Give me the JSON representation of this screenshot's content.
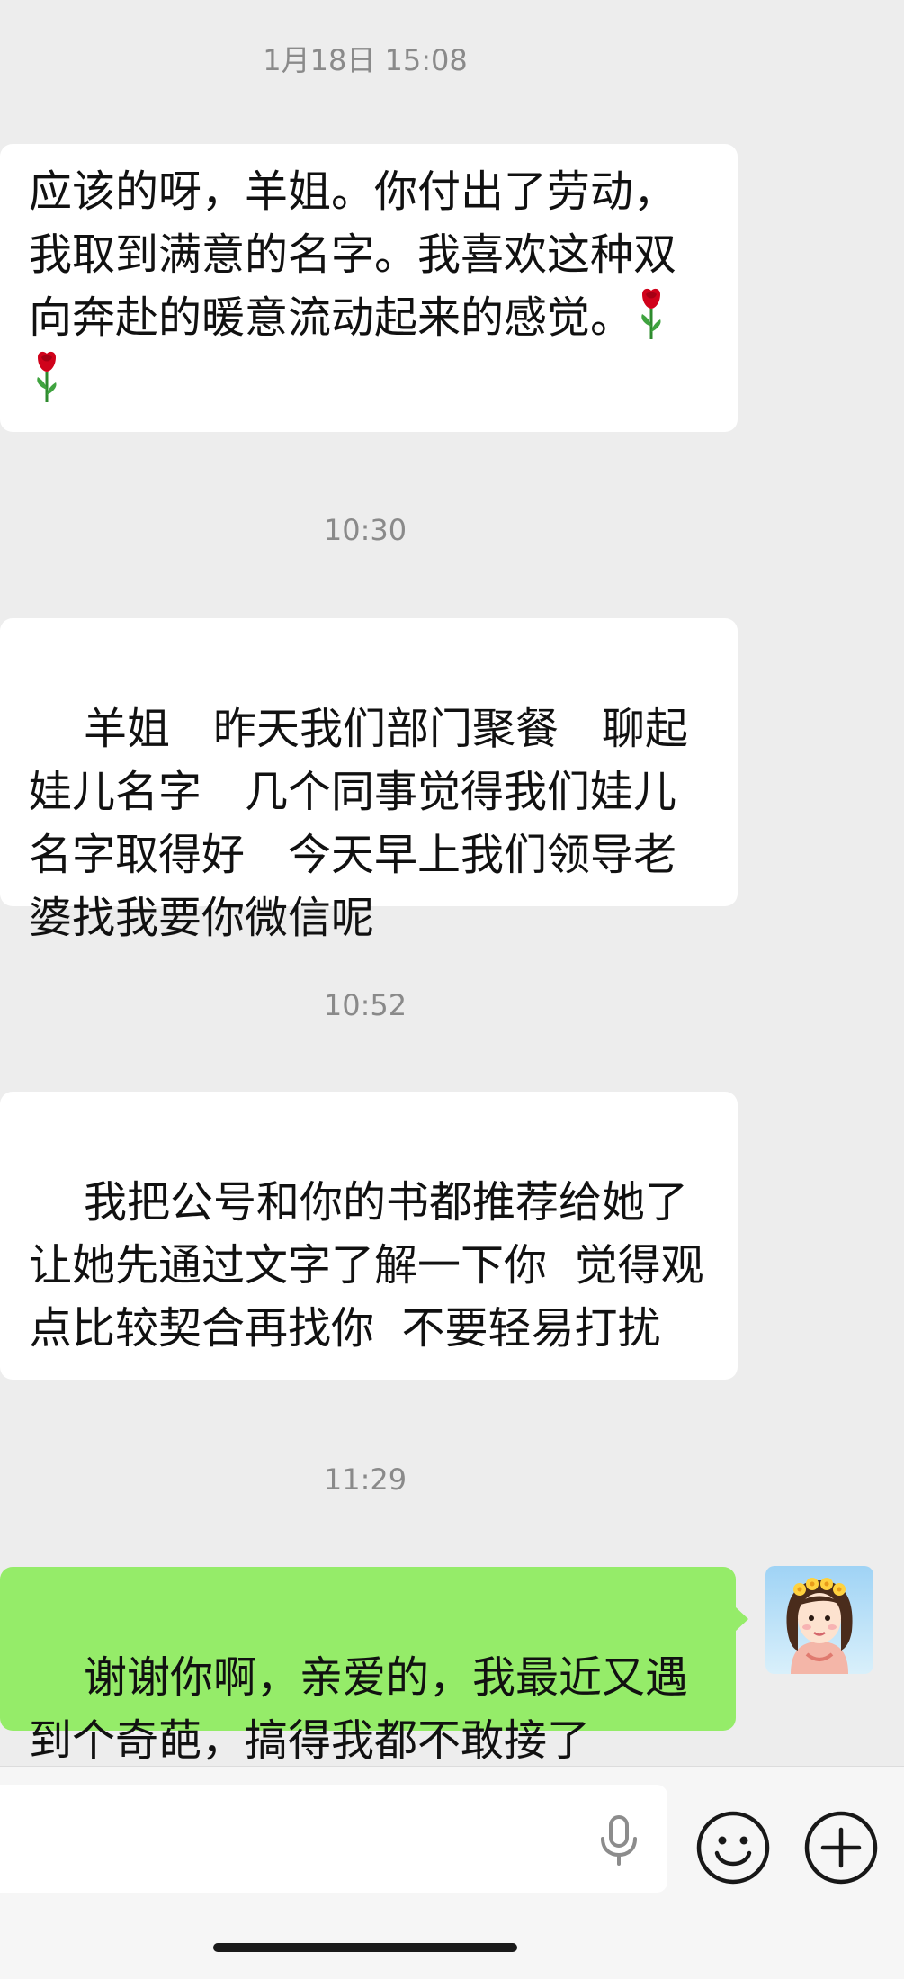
{
  "chat": {
    "messages": [
      {
        "type": "timestamp",
        "text": "1月18日 15:08"
      },
      {
        "type": "incoming",
        "text": "应该的呀，羊姐。你付出了劳动，我取到满意的名字。我喜欢这种双向奔赴的暖意流动起来的感觉。",
        "emoji": [
          "rose-emoji",
          "rose-emoji"
        ]
      },
      {
        "type": "timestamp",
        "text": "10:30"
      },
      {
        "type": "incoming",
        "text": "羊姐　昨天我们部门聚餐　聊起娃儿名字　几个同事觉得我们娃儿名字取得好　今天早上我们领导老婆找我要你微信呢"
      },
      {
        "type": "timestamp",
        "text": "10:52"
      },
      {
        "type": "incoming",
        "text": "我把公号和你的书都推荐给她了\n让她先通过文字了解一下你  觉得观点比较契合再找你  不要轻易打扰"
      },
      {
        "type": "timestamp",
        "text": "11:29"
      },
      {
        "type": "outgoing",
        "text": "谢谢你啊，亲爱的，我最近又遇到个奇葩，搞得我都不敢接了"
      }
    ]
  },
  "input_bar": {
    "input_value": "",
    "icons": [
      "microphone-icon",
      "emoji-icon",
      "add-icon"
    ]
  },
  "colors": {
    "background": "#ededed",
    "incoming_bubble": "#ffffff",
    "outgoing_bubble": "#95ec69",
    "timestamp": "#8a8a8a"
  }
}
